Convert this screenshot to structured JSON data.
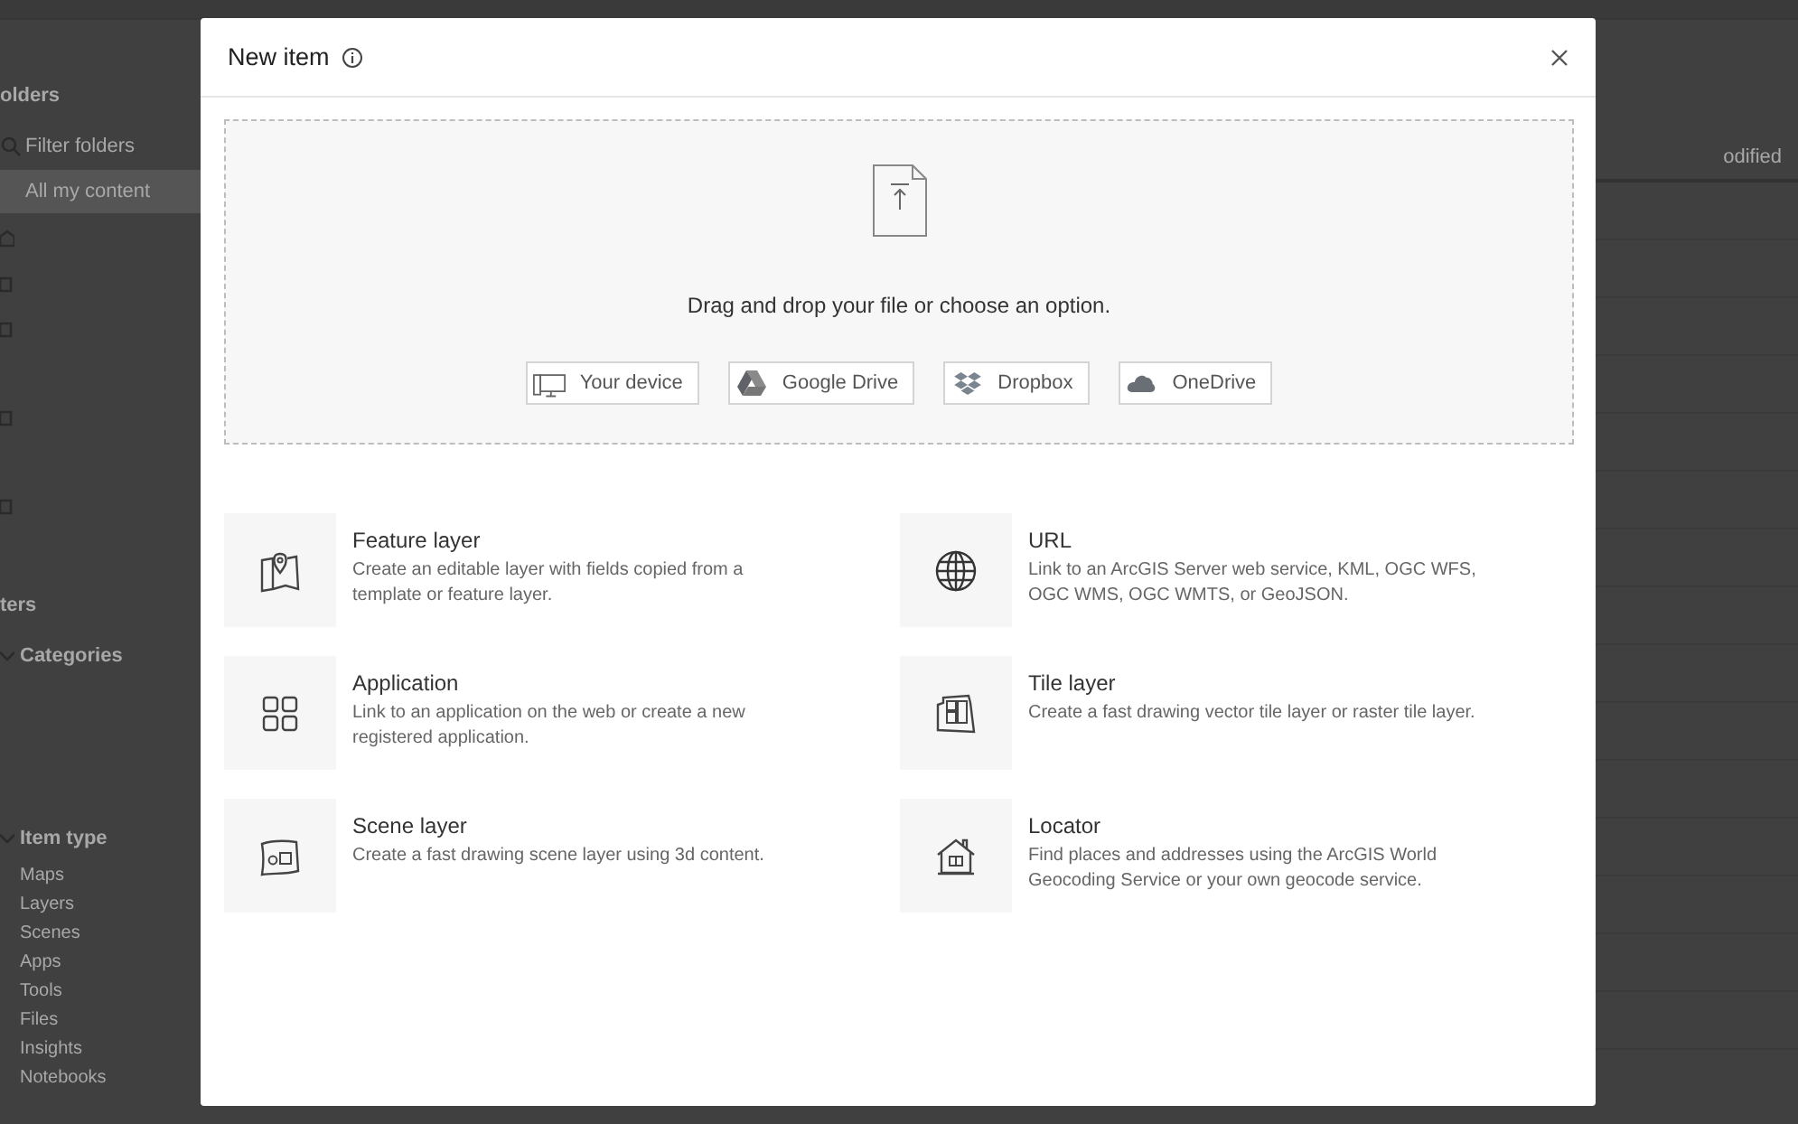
{
  "background": {
    "sidebar": {
      "folders_heading": "olders",
      "filter_placeholder": "Filter folders",
      "folders": [
        {
          "label": "All my content",
          "selected": true
        }
      ],
      "filters_heading": "ters",
      "sections": [
        {
          "label": "Categories",
          "expanded": true
        },
        {
          "label": "Item type",
          "expanded": true,
          "items": [
            "Maps",
            "Layers",
            "Scenes",
            "Apps",
            "Tools",
            "Files",
            "Insights",
            "Notebooks"
          ]
        }
      ]
    },
    "sort_header": "odified"
  },
  "modal": {
    "title": "New item",
    "dropzone": {
      "message": "Drag and drop your file or choose an option.",
      "sources": [
        {
          "label": "Your device",
          "kind": "device"
        },
        {
          "label": "Google Drive",
          "kind": "gdrive"
        },
        {
          "label": "Dropbox",
          "kind": "dropbox"
        },
        {
          "label": "OneDrive",
          "kind": "onedrive"
        }
      ]
    },
    "items": [
      {
        "title": "Feature layer",
        "description": "Create an editable layer with fields copied from a template or feature layer.",
        "kind": "feature"
      },
      {
        "title": "URL",
        "description": "Link to an ArcGIS Server web service, KML, OGC WFS, OGC WMS, OGC WMTS, or GeoJSON.",
        "kind": "url"
      },
      {
        "title": "Application",
        "description": "Link to an application on the web or create a new registered application.",
        "kind": "app"
      },
      {
        "title": "Tile layer",
        "description": "Create a fast drawing vector tile layer or raster tile layer.",
        "kind": "tile"
      },
      {
        "title": "Scene layer",
        "description": "Create a fast drawing scene layer using 3d content.",
        "kind": "scene"
      },
      {
        "title": "Locator",
        "description": "Find places and addresses using the ArcGIS World Geocoding Service or your own geocode service.",
        "kind": "locator"
      }
    ]
  }
}
